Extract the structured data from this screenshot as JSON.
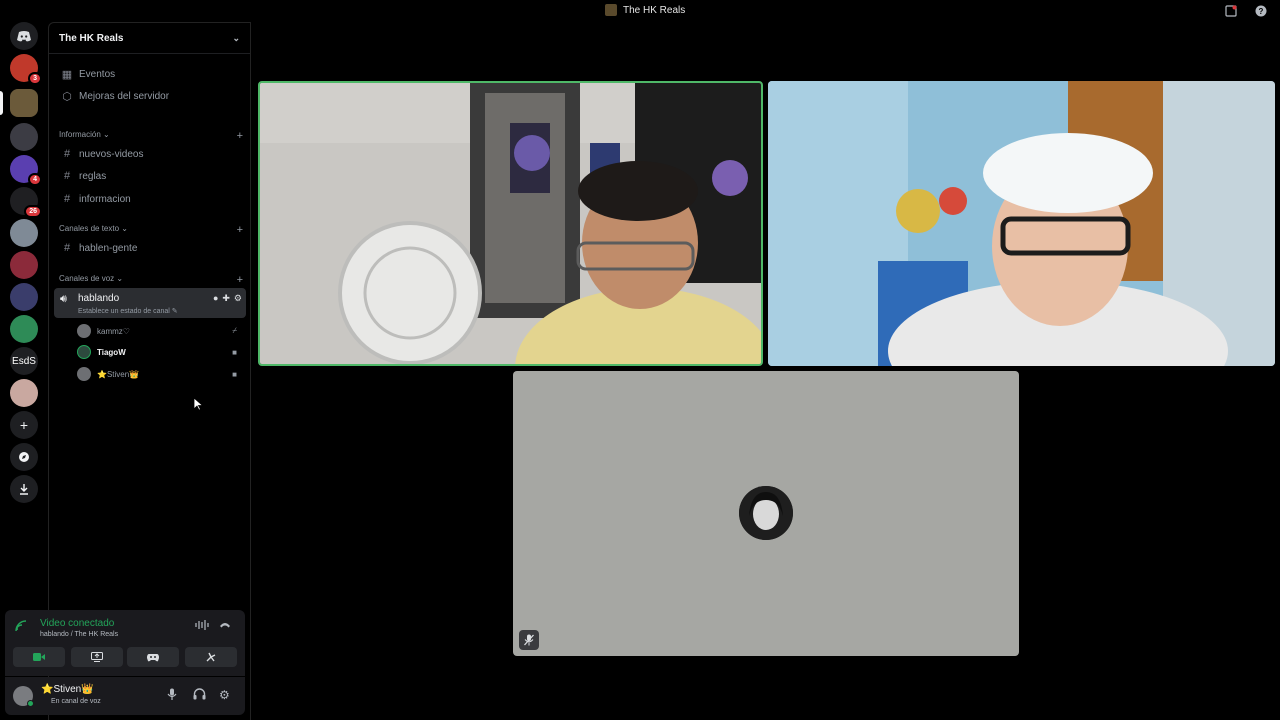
{
  "window": {
    "title": "The HK Reals",
    "inbox_icon": "inbox-icon",
    "help_icon": "help-icon"
  },
  "rail": {
    "servers": [
      {
        "name": "discord-home",
        "badge": ""
      },
      {
        "name": "server-1",
        "badge": "3"
      },
      {
        "name": "server-hk-reals",
        "badge": ""
      },
      {
        "name": "server-3",
        "badge": ""
      },
      {
        "name": "server-4",
        "badge": "4"
      },
      {
        "name": "server-5",
        "badge": "26"
      },
      {
        "name": "server-6",
        "badge": ""
      },
      {
        "name": "server-7",
        "badge": ""
      },
      {
        "name": "server-8",
        "badge": ""
      },
      {
        "name": "server-9",
        "badge": ""
      },
      {
        "name": "server-esds",
        "label": "EsdS",
        "badge": ""
      },
      {
        "name": "server-11",
        "badge": ""
      }
    ],
    "actions": [
      "add-server-icon",
      "discover-icon",
      "download-icon"
    ]
  },
  "sidebar": {
    "guild_name": "The HK Reals",
    "top_items": [
      {
        "label": "Eventos",
        "icon": "calendar-icon"
      },
      {
        "label": "Mejoras del servidor",
        "icon": "boost-icon"
      }
    ],
    "categories": [
      {
        "label": "Información",
        "channels": [
          "nuevos-videos",
          "reglas",
          "informacion"
        ]
      },
      {
        "label": "Canales de texto",
        "channels": [
          "hablen-gente"
        ]
      },
      {
        "label": "Canales de voz"
      }
    ],
    "voice_channel": {
      "name": "hablando",
      "status": "Establece un estado de canal"
    },
    "voice_users": [
      {
        "name": "kammz♡",
        "icon": "deafened-icon"
      },
      {
        "name": "TiagoW",
        "icon": "camera-icon"
      },
      {
        "name": "⭐Stiven👑",
        "icon": "camera-icon"
      }
    ]
  },
  "voice_panel": {
    "title": "Video conectado",
    "subtitle": "hablando / The HK Reals",
    "buttons": [
      "camera-icon",
      "screen-share-icon",
      "activity-icon",
      "soundboard-icon"
    ]
  },
  "user_panel": {
    "name": "⭐Stiven👑",
    "status": "En canal de voz"
  },
  "colors": {
    "accent_green": "#23a55a",
    "speaking_border": "#4fb868",
    "badge_red": "#da373c"
  }
}
